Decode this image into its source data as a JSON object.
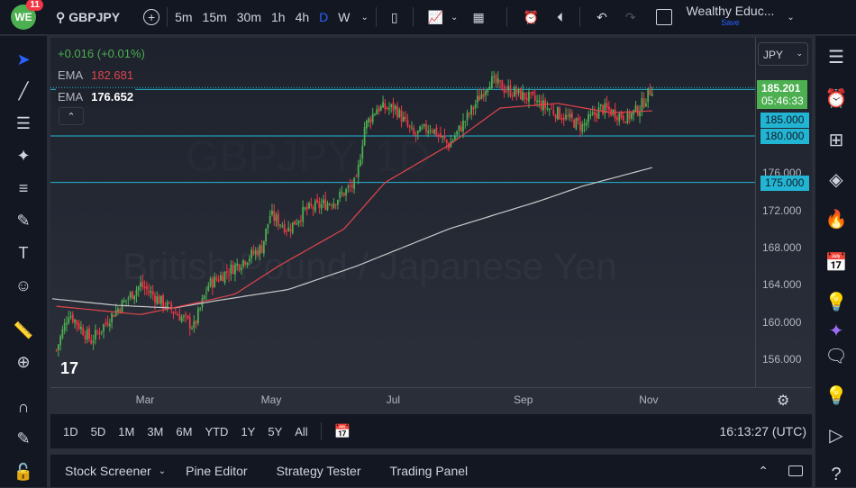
{
  "topbar": {
    "logo_text": "WE",
    "notification_count": "11",
    "symbol": "GBPJPY",
    "intervals": [
      "5m",
      "15m",
      "30m",
      "1h",
      "4h",
      "D",
      "W"
    ],
    "active_interval": "D",
    "layout_name": "Wealthy Educ...",
    "save_label": "Save"
  },
  "legend": {
    "change": "+0.016 (+0.01%)",
    "ema1_label": "EMA",
    "ema1_value": "182.681",
    "ema2_label": "EMA",
    "ema2_value": "176.652"
  },
  "watermark": {
    "line1": "GBPJPY, 1D",
    "line2": "British Pound / Japanese Yen"
  },
  "price_axis": {
    "currency": "JPY",
    "ticks": [
      "176.000",
      "172.000",
      "168.000",
      "164.000",
      "160.000",
      "156.000"
    ],
    "last_price": "185.201",
    "countdown": "05:46:33",
    "hlines": [
      "185.000",
      "180.000",
      "175.000"
    ]
  },
  "time_axis": {
    "labels": [
      "Mar",
      "May",
      "Jul",
      "Sep",
      "Nov"
    ]
  },
  "bottombar": {
    "ranges": [
      "1D",
      "5D",
      "1M",
      "3M",
      "6M",
      "YTD",
      "1Y",
      "5Y",
      "All"
    ],
    "clock": "16:13:27 (UTC)"
  },
  "panel": {
    "tabs": [
      "Stock Screener",
      "Pine Editor",
      "Strategy Tester",
      "Trading Panel"
    ]
  },
  "colors": {
    "up": "#4caf50",
    "down": "#f23645",
    "ema_fast": "#e0454c",
    "ema_slow": "#c9c9c9",
    "hline": "#22b5d3",
    "accent": "#2962ff"
  },
  "chart_data": {
    "type": "candlestick",
    "yaxis_range": [
      154,
      190
    ],
    "close_path": [
      [
        "01-17",
        157
      ],
      [
        "01-23",
        161
      ],
      [
        "02-03",
        158
      ],
      [
        "02-14",
        161
      ],
      [
        "02-27",
        164
      ],
      [
        "03-10",
        162
      ],
      [
        "03-25",
        159.5
      ],
      [
        "04-01",
        164
      ],
      [
        "04-14",
        166
      ],
      [
        "04-27",
        168
      ],
      [
        "05-01",
        171.5
      ],
      [
        "05-10",
        170
      ],
      [
        "05-18",
        172
      ],
      [
        "06-01",
        173
      ],
      [
        "06-12",
        175
      ],
      [
        "06-16",
        181
      ],
      [
        "06-22",
        183
      ],
      [
        "07-01",
        183
      ],
      [
        "07-10",
        180
      ],
      [
        "07-18",
        181
      ],
      [
        "07-27",
        179
      ],
      [
        "08-05",
        182
      ],
      [
        "08-16",
        186
      ],
      [
        "08-24",
        185
      ],
      [
        "09-05",
        184
      ],
      [
        "09-13",
        183
      ],
      [
        "09-22",
        182
      ],
      [
        "09-30",
        181
      ],
      [
        "10-09",
        183
      ],
      [
        "10-22",
        182
      ],
      [
        "10-28",
        183
      ],
      [
        "11-03",
        185.2
      ]
    ],
    "ema_fast": [
      [
        "01-17",
        161.7
      ],
      [
        "02-27",
        160.8
      ],
      [
        "03-25",
        162
      ],
      [
        "04-14",
        163
      ],
      [
        "05-05",
        166
      ],
      [
        "06-06",
        170
      ],
      [
        "06-26",
        175
      ],
      [
        "07-27",
        179
      ],
      [
        "08-21",
        183
      ],
      [
        "09-18",
        183.5
      ],
      [
        "10-14",
        182.5
      ],
      [
        "11-03",
        182.7
      ]
    ],
    "ema_slow": [
      [
        "01-15",
        162.5
      ],
      [
        "02-15",
        161.8
      ],
      [
        "03-15",
        161.5
      ],
      [
        "04-05",
        162.3
      ],
      [
        "05-10",
        163.5
      ],
      [
        "06-12",
        166
      ],
      [
        "07-27",
        170
      ],
      [
        "09-09",
        173
      ],
      [
        "09-30",
        174.6
      ],
      [
        "11-03",
        176.6
      ]
    ],
    "horizontal_lines": [
      185,
      180,
      175
    ]
  }
}
